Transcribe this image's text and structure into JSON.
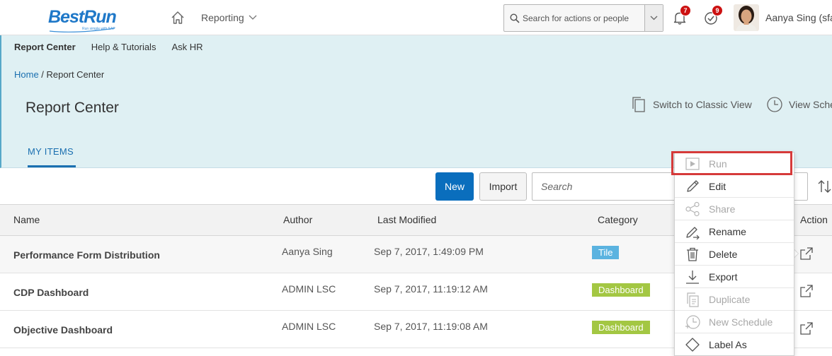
{
  "shell": {
    "logo_text": "BestRun",
    "logo_tagline": "Run simple with SAP",
    "home_icon": "home-icon",
    "menu_label": "Reporting",
    "search_placeholder": "Search for actions or people",
    "notifications_count": "7",
    "todo_count": "9",
    "user_name": "Aanya Sing (sfa"
  },
  "subnav": {
    "items": [
      "Report Center",
      "Help & Tutorials",
      "Ask HR"
    ],
    "active_index": 0
  },
  "breadcrumb": {
    "home": "Home",
    "separator": " / ",
    "current": "Report Center"
  },
  "page": {
    "title": "Report Center",
    "switch_view_label": "Switch to Classic View",
    "view_schedules_label": "View Sche"
  },
  "tabs": {
    "my_items": "MY ITEMS"
  },
  "toolbar": {
    "new_label": "New",
    "import_label": "Import",
    "search_placeholder": "Search"
  },
  "table": {
    "headers": {
      "name": "Name",
      "author": "Author",
      "last_modified": "Last Modified",
      "category": "Category",
      "action": "Action"
    },
    "rows": [
      {
        "name": "Performance Form Distribution",
        "author": "Aanya Sing",
        "last_modified": "Sep 7, 2017, 1:49:09 PM",
        "category": "Tile",
        "category_color": "#5bb3e0"
      },
      {
        "name": "CDP Dashboard",
        "author": "ADMIN LSC",
        "last_modified": "Sep 7, 2017, 11:19:12 AM",
        "category": "Dashboard",
        "category_color": "#a3c743"
      },
      {
        "name": "Objective Dashboard",
        "author": "ADMIN LSC",
        "last_modified": "Sep 7, 2017, 11:19:08 AM",
        "category": "Dashboard",
        "category_color": "#a3c743"
      }
    ]
  },
  "context_menu": {
    "items": [
      {
        "label": "Run",
        "icon": "play-icon",
        "disabled": true
      },
      {
        "label": "Edit",
        "icon": "pencil-icon",
        "disabled": false
      },
      {
        "label": "Share",
        "icon": "share-icon",
        "disabled": true
      },
      {
        "label": "Rename",
        "icon": "rename-icon",
        "disabled": false
      },
      {
        "label": "Delete",
        "icon": "trash-icon",
        "disabled": false
      },
      {
        "label": "Export",
        "icon": "download-icon",
        "disabled": false
      },
      {
        "label": "Duplicate",
        "icon": "copy-icon",
        "disabled": true
      },
      {
        "label": "New Schedule",
        "icon": "schedule-icon",
        "disabled": true
      },
      {
        "label": "Label As",
        "icon": "tag-icon",
        "disabled": false
      }
    ]
  },
  "colors": {
    "brand_blue": "#1f78c8",
    "primary_button": "#0a6ebd",
    "header_bg": "#dff0f3",
    "highlight": "#d63a3a",
    "badge": "#cc1111"
  }
}
